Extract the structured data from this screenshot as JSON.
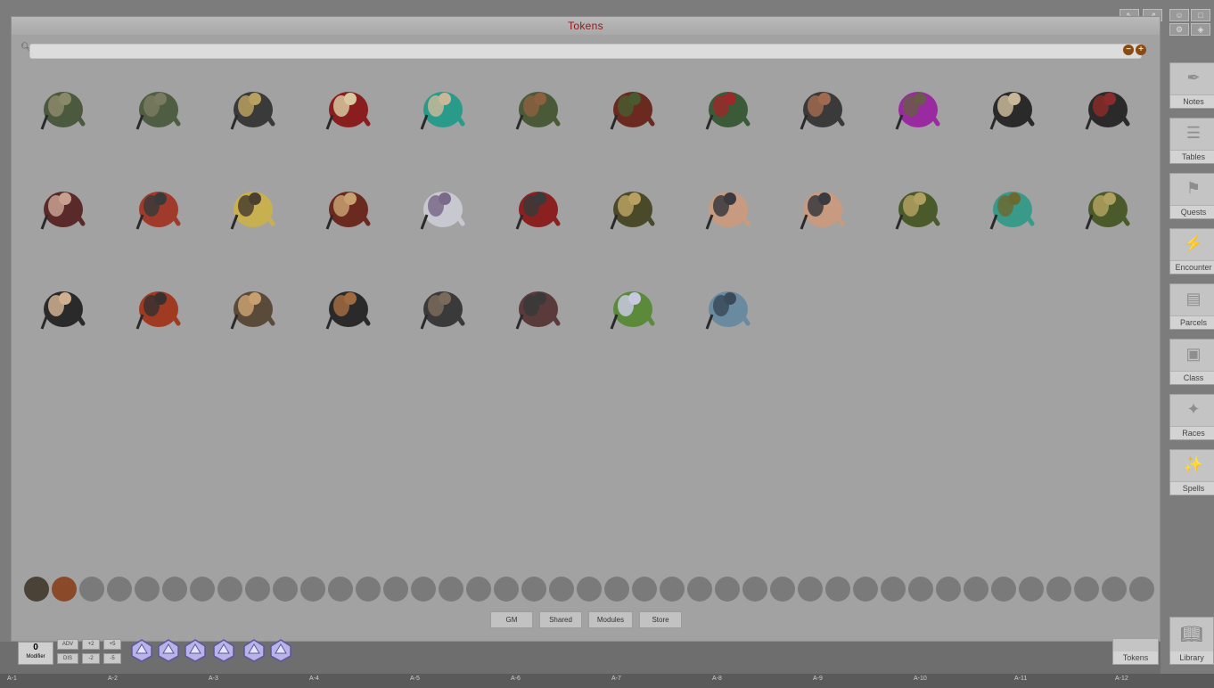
{
  "window": {
    "title": "Tokens"
  },
  "search": {
    "placeholder": ""
  },
  "tokens": [
    {
      "c1": "#4b5a3e",
      "c2": "#8a8a6a"
    },
    {
      "c1": "#4f5d42",
      "c2": "#7a7a60"
    },
    {
      "c1": "#3a3a3a",
      "c2": "#b8a060"
    },
    {
      "c1": "#8a1d1d",
      "c2": "#d8c8a0"
    },
    {
      "c1": "#2a9a8a",
      "c2": "#c8b898"
    },
    {
      "c1": "#4a5a38",
      "c2": "#8a6040"
    },
    {
      "c1": "#6a2a20",
      "c2": "#4a5a30"
    },
    {
      "c1": "#3a5a38",
      "c2": "#9a2a2a"
    },
    {
      "c1": "#3a3a3a",
      "c2": "#a06a50"
    },
    {
      "c1": "#9a2aa0",
      "c2": "#6a5a4a"
    },
    {
      "c1": "#2a2a2a",
      "c2": "#c8b898"
    },
    {
      "c1": "#2a2a2a",
      "c2": "#8a2a2a"
    },
    {
      "c1": "#5a2a2a",
      "c2": "#c8a090"
    },
    {
      "c1": "#a03a2a",
      "c2": "#3a3a3a"
    },
    {
      "c1": "#c8b050",
      "c2": "#4a4030"
    },
    {
      "c1": "#6a2a20",
      "c2": "#c8a070"
    },
    {
      "c1": "#c8c8d0",
      "c2": "#7a6a8a"
    },
    {
      "c1": "#8a2020",
      "c2": "#3a3a3a"
    },
    {
      "c1": "#4a4a2a",
      "c2": "#b8a060"
    },
    {
      "c1": "#c89a80",
      "c2": "#3a3a40"
    },
    {
      "c1": "#c89a80",
      "c2": "#3a3a40"
    },
    {
      "c1": "#4a5a2a",
      "c2": "#b0a060"
    },
    {
      "c1": "#3a9a8a",
      "c2": "#6a6a30"
    },
    {
      "c1": "#4a5a2a",
      "c2": "#b0a060"
    },
    {
      "c1": "#2a2a2a",
      "c2": "#d0b090"
    },
    {
      "c1": "#a03a20",
      "c2": "#3a3030"
    },
    {
      "c1": "#5a4a3a",
      "c2": "#c8a070"
    },
    {
      "c1": "#2a2a2a",
      "c2": "#a06a40"
    },
    {
      "c1": "#3a3a3a",
      "c2": "#7a6a5a"
    },
    {
      "c1": "#5a3a3a",
      "c2": "#3a3a3a"
    },
    {
      "c1": "#5a8a3a",
      "c2": "#c8c8e0"
    },
    {
      "c1": "#6a8aa0",
      "c2": "#3a4a5a"
    }
  ],
  "tabs": [
    "GM",
    "Shared",
    "Modules",
    "Store"
  ],
  "sidebar": [
    {
      "label": "Notes",
      "icon": "feather-icon",
      "glyph": "✒"
    },
    {
      "label": "Tables",
      "icon": "list-icon",
      "glyph": "☰"
    },
    {
      "label": "Quests",
      "icon": "flag-icon",
      "glyph": "⚑"
    },
    {
      "label": "Encounter",
      "icon": "lightning-icon",
      "glyph": "⚡"
    },
    {
      "label": "Parcels",
      "icon": "box-icon",
      "glyph": "▤"
    },
    {
      "label": "Class",
      "icon": "badge-icon",
      "glyph": "▣"
    },
    {
      "label": "Races",
      "icon": "dna-icon",
      "glyph": "✦"
    },
    {
      "label": "Spells",
      "icon": "wand-icon",
      "glyph": "✨"
    }
  ],
  "modifier": {
    "value": "0",
    "label": "Modifier"
  },
  "modifier_buttons": [
    {
      "label": "ADV"
    },
    {
      "label": "+2"
    },
    {
      "label": "+5"
    },
    {
      "label": "DIS"
    },
    {
      "label": "-2"
    },
    {
      "label": "-5"
    }
  ],
  "dice": [
    "d20",
    "d12",
    "d10",
    "d8",
    "d6",
    "d4"
  ],
  "bottom_tabs": {
    "tokens": "Tokens",
    "library": "Library"
  },
  "ruler": [
    "A-1",
    "A-2",
    "A-3",
    "A-4",
    "A-5",
    "A-6",
    "A-7",
    "A-8",
    "A-9",
    "A-10",
    "A-11",
    "A-12"
  ]
}
